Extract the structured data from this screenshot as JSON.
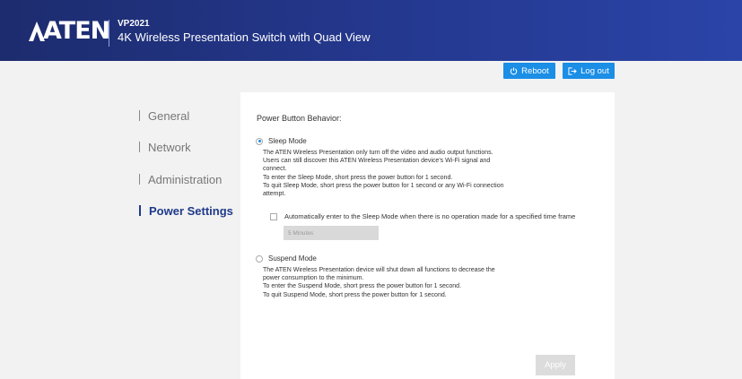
{
  "header": {
    "logo_text": "ATEN",
    "model": "VP2021",
    "product_name": "4K Wireless Presentation Switch with Quad View",
    "gradient_start": "#1d2c6e",
    "gradient_end": "#2a44a8"
  },
  "toolbar": {
    "reboot_label": "Reboot",
    "logout_label": "Log out",
    "accent": "#1b8ee6"
  },
  "sidebar": {
    "items": [
      {
        "label": "General",
        "active": false
      },
      {
        "label": "Network",
        "active": false
      },
      {
        "label": "Administration",
        "active": false
      },
      {
        "label": "Power Settings",
        "active": true
      }
    ]
  },
  "power": {
    "section_title": "Power Button Behavior:",
    "selected_mode": "Sleep Mode",
    "sleep": {
      "label": "Sleep Mode",
      "selected": true,
      "description": [
        "The ATEN Wireless Presentation only turn off the video and audio output functions.",
        "Users can still discover this ATEN Wireless Presentation device's Wi-Fi signal and",
        "connect.",
        "To enter the Sleep Mode, short press the power button for 1 second.",
        "To quit Sleep Mode, short press the power button for 1 second or any Wi-Fi connection",
        "attempt."
      ],
      "auto_sleep_label": "Automatically enter to the Sleep Mode when there is no operation made for a specified time frame",
      "auto_sleep_checked": false,
      "timeout_value": "5 Minutes"
    },
    "suspend": {
      "label": "Suspend Mode",
      "selected": false,
      "description": [
        "The ATEN Wireless Presentation device will shut down all functions to decrease the",
        "power consumption to the minimum.",
        "To enter the Suspend Mode, short press the power button for 1 second.",
        "To quit Suspend Mode, short press the power button for 1 second."
      ]
    },
    "apply_label": "Apply"
  }
}
